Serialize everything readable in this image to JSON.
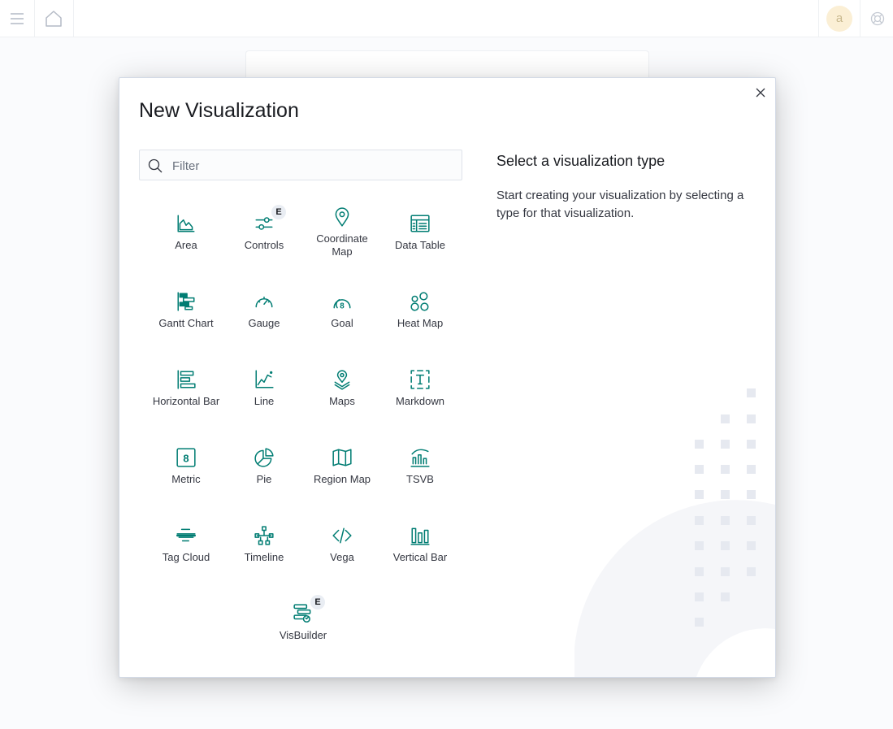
{
  "header": {
    "menu_icon": "hamburger-icon",
    "home_icon": "home-icon",
    "avatar_initial": "a",
    "help_icon": "help-icon"
  },
  "modal": {
    "title": "New Visualization",
    "close_icon": "close-icon",
    "search": {
      "placeholder": "Filter",
      "value": ""
    },
    "description": {
      "title": "Select a visualization type",
      "text": "Start creating your visualization by selecting a type for that visualization."
    },
    "types": [
      {
        "label": "Area",
        "icon": "area-chart-icon"
      },
      {
        "label": "Controls",
        "icon": "controls-icon",
        "badge": "E"
      },
      {
        "label": "Coordinate Map",
        "icon": "map-pin-icon"
      },
      {
        "label": "Data Table",
        "icon": "table-icon"
      },
      {
        "label": "Gantt Chart",
        "icon": "gantt-icon"
      },
      {
        "label": "Gauge",
        "icon": "gauge-icon"
      },
      {
        "label": "Goal",
        "icon": "goal-icon"
      },
      {
        "label": "Heat Map",
        "icon": "heatmap-icon"
      },
      {
        "label": "Horizontal Bar",
        "icon": "horizontal-bar-icon"
      },
      {
        "label": "Line",
        "icon": "line-chart-icon"
      },
      {
        "label": "Maps",
        "icon": "maps-icon"
      },
      {
        "label": "Markdown",
        "icon": "markdown-icon"
      },
      {
        "label": "Metric",
        "icon": "metric-icon"
      },
      {
        "label": "Pie",
        "icon": "pie-chart-icon"
      },
      {
        "label": "Region Map",
        "icon": "region-map-icon"
      },
      {
        "label": "TSVB",
        "icon": "tsvb-icon"
      },
      {
        "label": "Tag Cloud",
        "icon": "tag-cloud-icon"
      },
      {
        "label": "Timeline",
        "icon": "timeline-icon"
      },
      {
        "label": "Vega",
        "icon": "code-icon"
      },
      {
        "label": "Vertical Bar",
        "icon": "vertical-bar-icon"
      },
      {
        "label": "VisBuilder",
        "icon": "visbuilder-icon",
        "badge": "E"
      }
    ]
  },
  "colors": {
    "accent": "#017d73",
    "badge_bg": "#e9edf3",
    "avatar_bg": "#fbefd5"
  }
}
